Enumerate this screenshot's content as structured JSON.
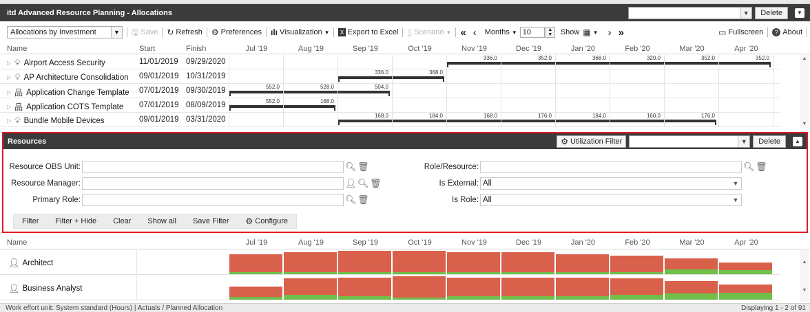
{
  "app": {
    "title": "itd Advanced Resource Planning - Allocations",
    "delete_label": "Delete",
    "header_select_value": ""
  },
  "toolbar": {
    "view_select": "Allocations by Investment",
    "save": "Save",
    "refresh": "Refresh",
    "preferences": "Preferences",
    "visualization": "Visualization",
    "export": "Export to Excel",
    "scenario": "Scenario",
    "months": "Months",
    "months_count": "10",
    "show": "Show",
    "fullscreen": "Fullscreen",
    "about": "About"
  },
  "grid": {
    "headers": {
      "name": "Name",
      "start": "Start",
      "finish": "Finish"
    },
    "months": [
      "Jul '19",
      "Aug '19",
      "Sep '19",
      "Oct '19",
      "Nov '19",
      "Dec '19",
      "Jan '20",
      "Feb '20",
      "Mar '20",
      "Apr '20"
    ],
    "rows": [
      {
        "name": "Airport Access Security",
        "icon": "lightbulb-icon",
        "start": "11/01/2019",
        "finish": "09/29/2020",
        "values": [
          "",
          "",
          "",
          "",
          "336.0",
          "352.0",
          "368.0",
          "320.0",
          "352.0",
          "352.0"
        ]
      },
      {
        "name": "AP Architecture Consolidation",
        "icon": "lightbulb-icon",
        "start": "09/01/2019",
        "finish": "10/31/2019",
        "values": [
          "",
          "",
          "336.0",
          "368.0",
          "",
          "",
          "",
          "",
          "",
          ""
        ]
      },
      {
        "name": "Application Change Template",
        "icon": "hierarchy-icon",
        "start": "07/01/2019",
        "finish": "09/30/2019",
        "values": [
          "552.0",
          "528.0",
          "504.0",
          "",
          "",
          "",
          "",
          "",
          "",
          ""
        ]
      },
      {
        "name": "Application COTS Template",
        "icon": "hierarchy-icon",
        "start": "07/01/2019",
        "finish": "08/09/2019",
        "values": [
          "552.0",
          "168.0",
          "",
          "",
          "",
          "",
          "",
          "",
          "",
          ""
        ]
      },
      {
        "name": "Bundle Mobile Devices",
        "icon": "lightbulb-icon",
        "start": "09/01/2019",
        "finish": "03/31/2020",
        "values": [
          "",
          "",
          "168.0",
          "184.0",
          "168.0",
          "176.0",
          "184.0",
          "160.0",
          "176.0",
          ""
        ]
      }
    ]
  },
  "resources": {
    "title": "Resources",
    "utilization_filter": "Utilization Filter",
    "delete_label": "Delete",
    "filter_select_value": "",
    "fields": {
      "obs_unit": {
        "label": "Resource OBS Unit:",
        "value": ""
      },
      "manager": {
        "label": "Resource Manager:",
        "value": ""
      },
      "primary_role": {
        "label": "Primary Role:",
        "value": ""
      },
      "role_resource": {
        "label": "Role/Resource:",
        "value": ""
      },
      "is_external": {
        "label": "Is External:",
        "value": "All"
      },
      "is_role": {
        "label": "Is Role:",
        "value": "All"
      }
    },
    "buttons": [
      "Filter",
      "Filter + Hide",
      "Clear",
      "Show all",
      "Save Filter",
      "Configure"
    ],
    "header_name": "Name",
    "rows": [
      {
        "name": "Architect",
        "actual": [
          1.0,
          1.0,
          1.0,
          1.0,
          1.0,
          1.0,
          1.0,
          1.0,
          1.0,
          1.0
        ],
        "planned": [
          0.0,
          0.08,
          0.08,
          0.08,
          0.05,
          0.08,
          0.1,
          0.1,
          0.2,
          0.18
        ],
        "fill": [
          0.85,
          0.95,
          1.0,
          1.0,
          0.95,
          0.95,
          0.85,
          0.8,
          0.68,
          0.5
        ]
      },
      {
        "name": "Business Analyst",
        "actual": [
          1.0,
          1.0,
          1.0,
          1.0,
          1.0,
          1.0,
          1.0,
          1.0,
          1.0,
          1.0
        ],
        "planned": [
          0.12,
          0.22,
          0.15,
          0.08,
          0.15,
          0.15,
          0.15,
          0.2,
          0.25,
          0.3
        ],
        "fill": [
          0.55,
          0.9,
          0.95,
          1.0,
          0.95,
          0.95,
          0.95,
          0.9,
          0.8,
          0.65
        ]
      }
    ]
  },
  "status": {
    "left": "Work effort unit: System standard (Hours) | Actuals / Planned Allocation",
    "right": "Displaying 1 - 2 of 91"
  },
  "colors": {
    "overallocated": "#d9604a",
    "planned": "#6fbf4a",
    "highlight_border": "#e01b24"
  }
}
